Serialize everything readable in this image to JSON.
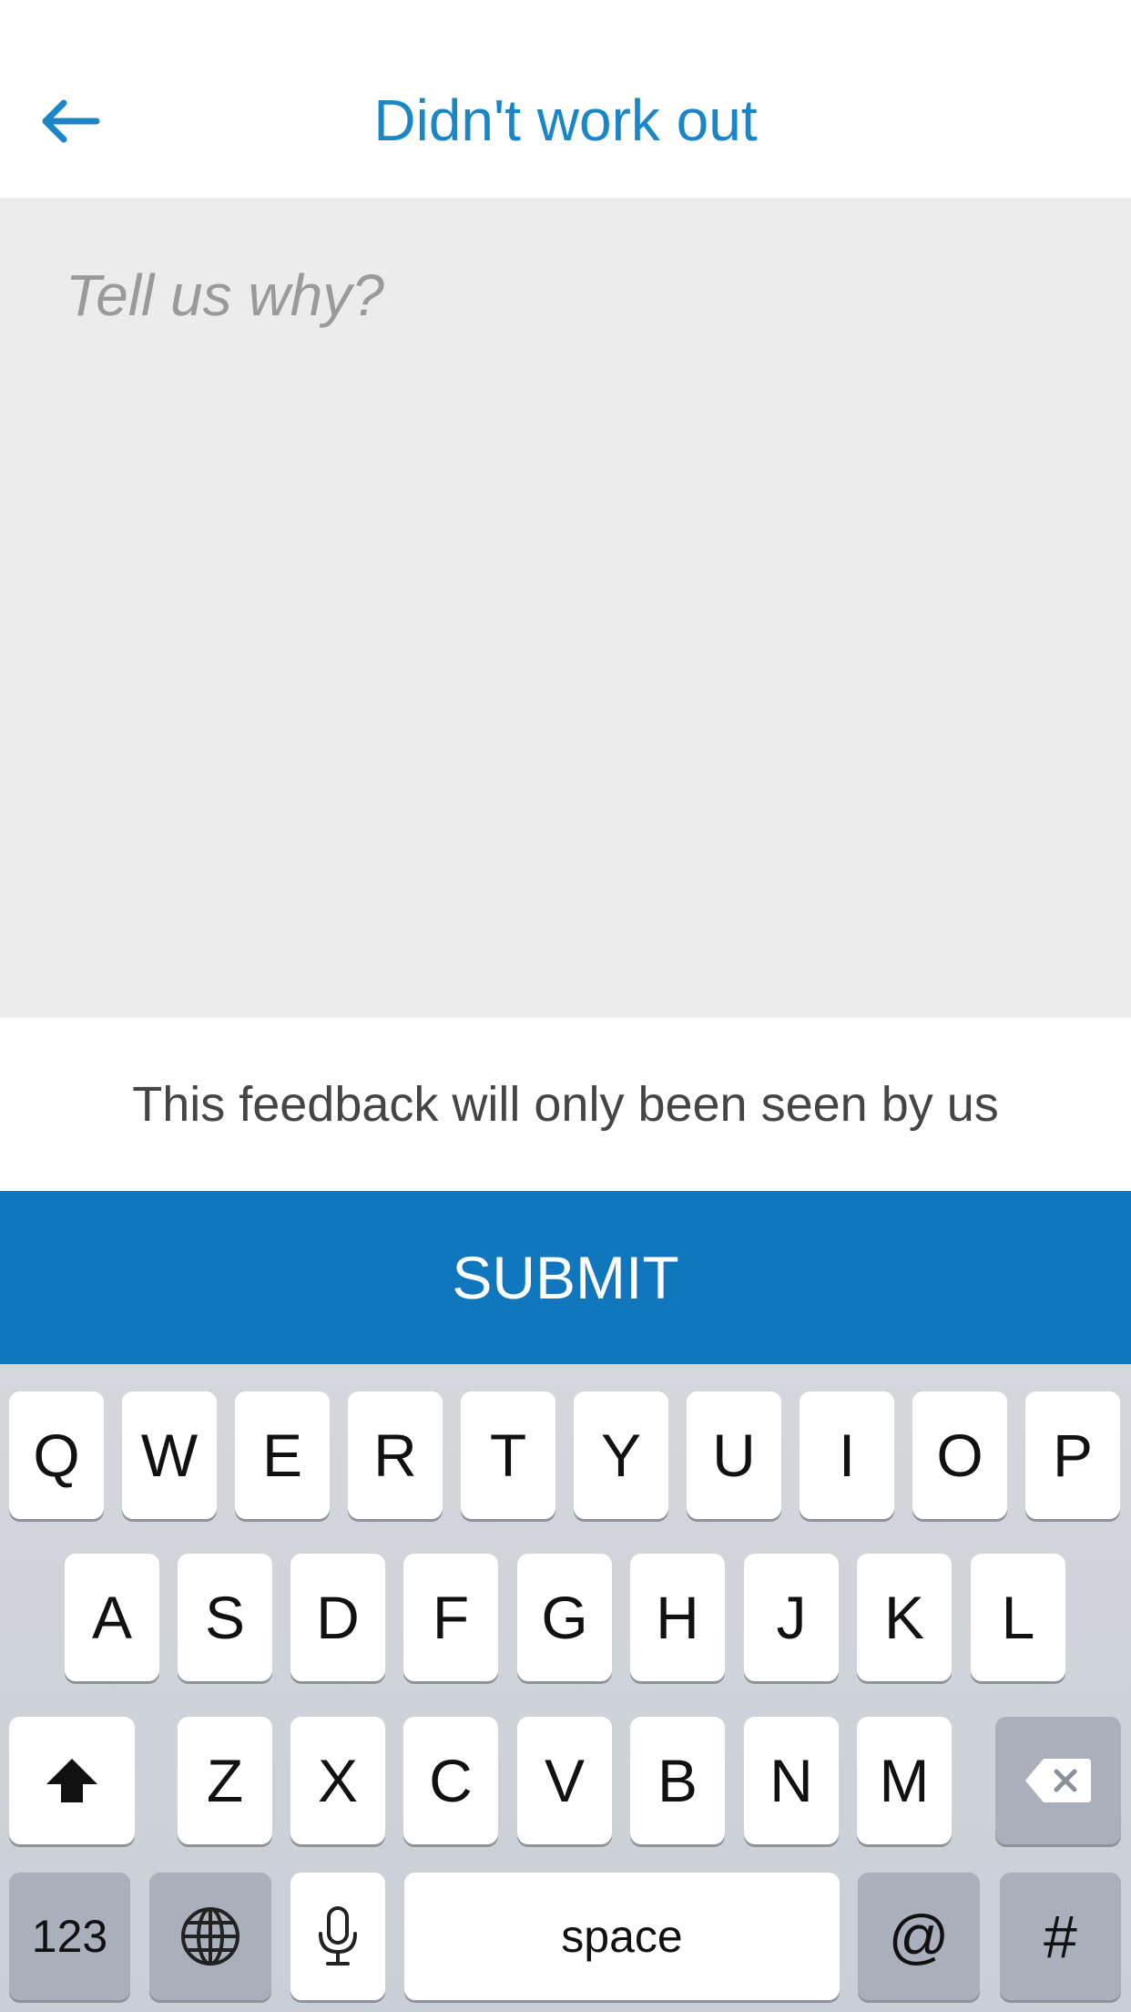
{
  "header": {
    "title": "Didn't work out",
    "back_icon": "arrow-left-icon"
  },
  "feedback": {
    "placeholder": "Tell us why?",
    "value": ""
  },
  "notice": "This feedback will only been seen by us",
  "submit_label": "SUBMIT",
  "keyboard": {
    "row1": [
      "Q",
      "W",
      "E",
      "R",
      "T",
      "Y",
      "U",
      "I",
      "O",
      "P"
    ],
    "row2": [
      "A",
      "S",
      "D",
      "F",
      "G",
      "H",
      "J",
      "K",
      "L"
    ],
    "row3": [
      "Z",
      "X",
      "C",
      "V",
      "B",
      "N",
      "M"
    ],
    "numbers_label": "123",
    "space_label": "space",
    "at_label": "@",
    "hash_label": "#"
  },
  "colors": {
    "accent": "#1177bd",
    "title": "#1a86c8",
    "input_bg": "#ececec"
  }
}
